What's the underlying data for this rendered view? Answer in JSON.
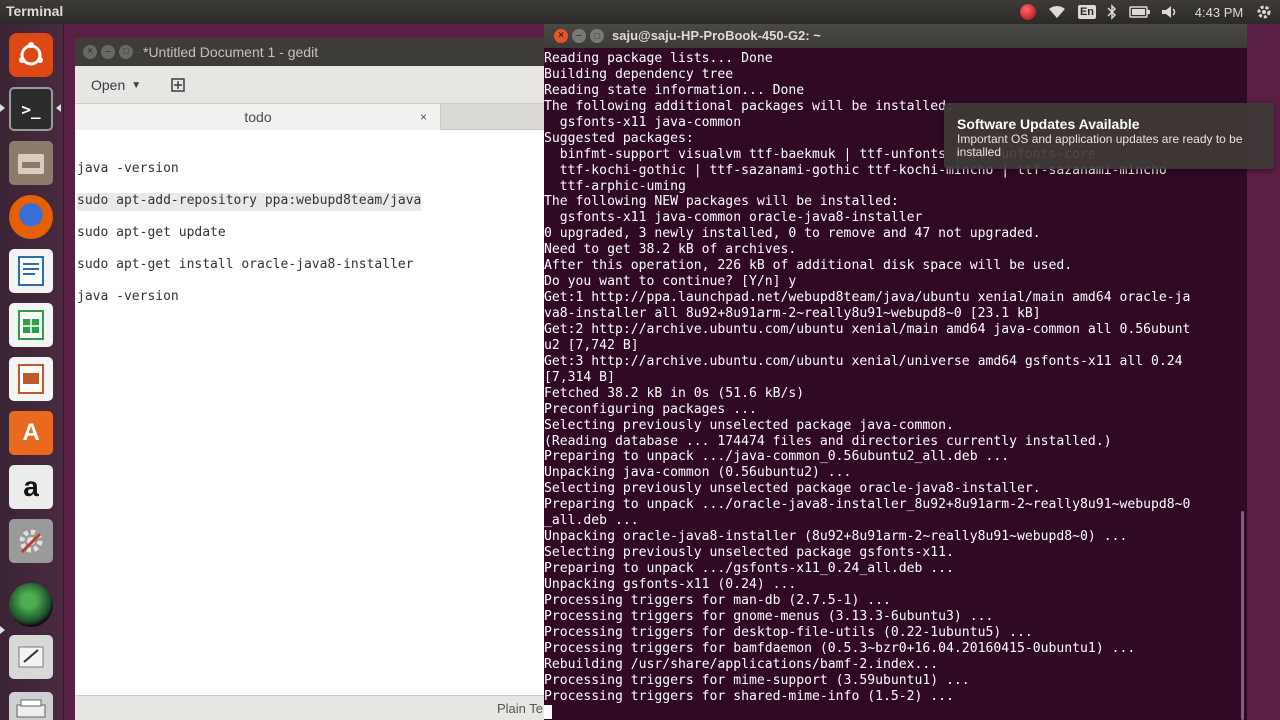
{
  "top_panel": {
    "title": "Terminal",
    "keyboard_layout": "En",
    "clock": "4:43 PM"
  },
  "launcher": {
    "items": [
      {
        "name": "ubuntu-dash-icon",
        "color": "#dd4814"
      },
      {
        "name": "terminal-icon",
        "color": "#2c2c2c"
      },
      {
        "name": "files-icon",
        "color": "#8c7b6b"
      },
      {
        "name": "firefox-icon",
        "color": "#e66000"
      },
      {
        "name": "libreoffice-writer-icon",
        "color": "#2a6bb5"
      },
      {
        "name": "libreoffice-calc-icon",
        "color": "#2f9e44"
      },
      {
        "name": "libreoffice-impress-icon",
        "color": "#c0582a"
      },
      {
        "name": "software-center-icon",
        "color": "#e96a1f"
      },
      {
        "name": "amazon-icon",
        "color": "#e8e8e8"
      },
      {
        "name": "system-settings-icon",
        "color": "#b8b8b8"
      },
      {
        "name": "app-globe-icon",
        "color": "#2d6a3a"
      },
      {
        "name": "text-editor-icon",
        "color": "#d8d8d8"
      },
      {
        "name": "scanner-icon",
        "color": "#cfcfcf"
      }
    ]
  },
  "gedit": {
    "title": "*Untitled Document 1 - gedit",
    "open_label": "Open",
    "tab_label": "todo",
    "tab_close": "×",
    "lines": [
      "java -version",
      "sudo apt-add-repository ppa:webupd8team/java",
      "sudo apt-get update",
      "sudo apt-get install oracle-java8-installer",
      "java -version"
    ],
    "status_language": "Plain Te"
  },
  "terminal": {
    "title": "saju@saju-HP-ProBook-450-G2: ~",
    "lines": [
      "Reading package lists... Done",
      "Building dependency tree",
      "Reading state information... Done",
      "The following additional packages will be installed:",
      "  gsfonts-x11 java-common",
      "Suggested packages:",
      "  binfmt-support visualvm ttf-baekmuk | ttf-unfonts | ttf-unfonts-core",
      "  ttf-kochi-gothic | ttf-sazanami-gothic ttf-kochi-mincho | ttf-sazanami-mincho",
      "  ttf-arphic-uming",
      "The following NEW packages will be installed:",
      "  gsfonts-x11 java-common oracle-java8-installer",
      "0 upgraded, 3 newly installed, 0 to remove and 47 not upgraded.",
      "Need to get 38.2 kB of archives.",
      "After this operation, 226 kB of additional disk space will be used.",
      "Do you want to continue? [Y/n] y",
      "Get:1 http://ppa.launchpad.net/webupd8team/java/ubuntu xenial/main amd64 oracle-ja",
      "va8-installer all 8u92+8u91arm-2~really8u91~webupd8~0 [23.1 kB]",
      "Get:2 http://archive.ubuntu.com/ubuntu xenial/main amd64 java-common all 0.56ubunt",
      "u2 [7,742 B]",
      "Get:3 http://archive.ubuntu.com/ubuntu xenial/universe amd64 gsfonts-x11 all 0.24",
      "[7,314 B]",
      "Fetched 38.2 kB in 0s (51.6 kB/s)",
      "Preconfiguring packages ...",
      "Selecting previously unselected package java-common.",
      "(Reading database ... 174474 files and directories currently installed.)",
      "Preparing to unpack .../java-common_0.56ubuntu2_all.deb ...",
      "Unpacking java-common (0.56ubuntu2) ...",
      "Selecting previously unselected package oracle-java8-installer.",
      "Preparing to unpack .../oracle-java8-installer_8u92+8u91arm-2~really8u91~webupd8~0",
      "_all.deb ...",
      "Unpacking oracle-java8-installer (8u92+8u91arm-2~really8u91~webupd8~0) ...",
      "Selecting previously unselected package gsfonts-x11.",
      "Preparing to unpack .../gsfonts-x11_0.24_all.deb ...",
      "Unpacking gsfonts-x11 (0.24) ...",
      "Processing triggers for man-db (2.7.5-1) ...",
      "Processing triggers for gnome-menus (3.13.3-6ubuntu3) ...",
      "Processing triggers for desktop-file-utils (0.22-1ubuntu5) ...",
      "Processing triggers for bamfdaemon (0.5.3~bzr0+16.04.20160415-0ubuntu1) ...",
      "Rebuilding /usr/share/applications/bamf-2.index...",
      "Processing triggers for mime-support (3.59ubuntu1) ...",
      "Processing triggers for shared-mime-info (1.5-2) ..."
    ]
  },
  "notification": {
    "title": "Software Updates Available",
    "body": "Important OS and application updates are ready to be installed"
  }
}
